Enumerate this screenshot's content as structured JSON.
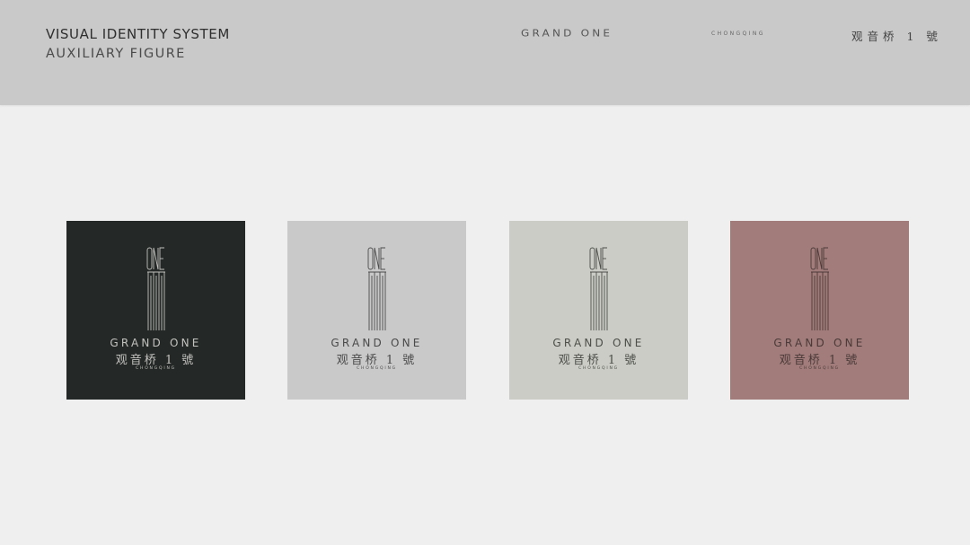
{
  "header": {
    "title": "VISUAL IDENTITY SYSTEM",
    "subtitle": "AUXILIARY FIGURE",
    "brand_en": "GRAND ONE",
    "brand_city": "CHONGQING",
    "brand_cn": "观音桥 1 號"
  },
  "logo": {
    "mark_text": "ONE",
    "name_en": "GRAND ONE",
    "name_cn": "观音桥 1 號",
    "city": "CHONGQING"
  },
  "tiles": [
    {
      "bg": "#242826",
      "fg": "#c2c2bf"
    },
    {
      "bg": "#c9c9c9",
      "fg": "#4a4a4a"
    },
    {
      "bg": "#caccc5",
      "fg": "#4d4e4a"
    },
    {
      "bg": "#a17c7a",
      "fg": "#4a3a39"
    }
  ]
}
